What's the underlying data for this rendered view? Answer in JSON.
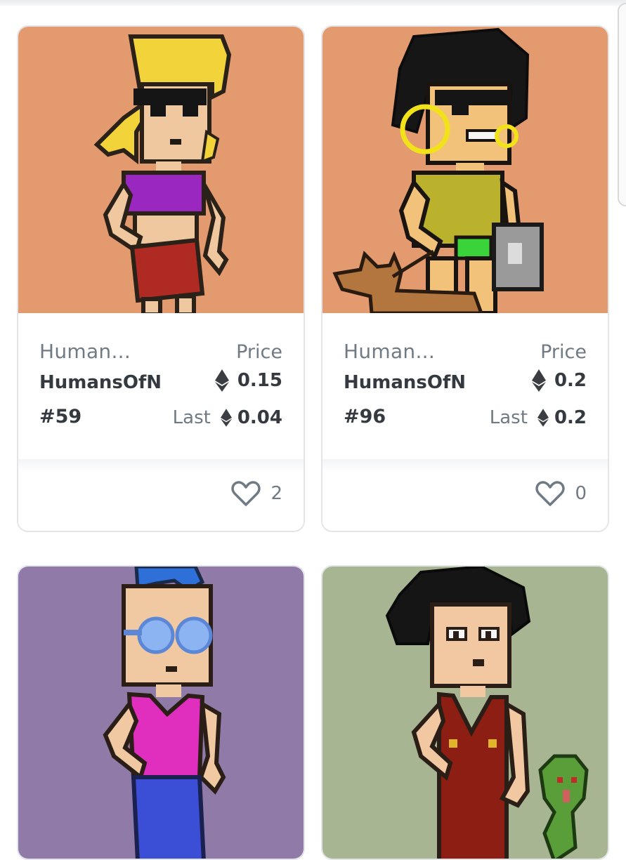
{
  "cards": [
    {
      "collection": "Human...",
      "token_name": "HumansOfN",
      "token_number": "#59",
      "price_label": "Price",
      "price": "0.15",
      "last_label": "Last",
      "last_price": "0.04",
      "likes": "2",
      "art_background": "#e39a6e"
    },
    {
      "collection": "Human...",
      "token_name": "HumansOfN",
      "token_number": "#96",
      "price_label": "Price",
      "price": "0.2",
      "last_label": "Last",
      "last_price": "0.2",
      "likes": "0",
      "art_background": "#e39a6e"
    },
    {
      "art_background": "#8f7aa8"
    },
    {
      "art_background": "#a7b592"
    }
  ],
  "icons": {
    "currency": "ethereum-icon",
    "like": "heart-icon"
  },
  "colors": {
    "card_border": "#e3e5e8",
    "muted_text": "#707a84",
    "strong_text": "#353a40"
  }
}
